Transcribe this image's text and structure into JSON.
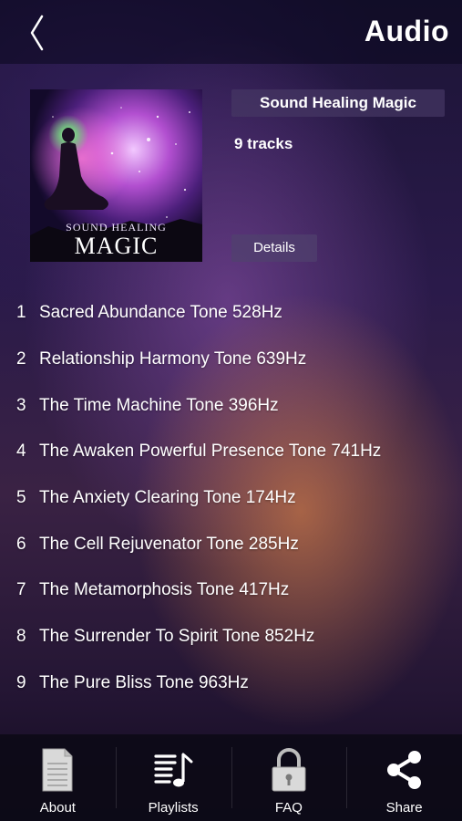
{
  "header": {
    "title": "Audio"
  },
  "album": {
    "name": "Sound Healing Magic",
    "track_count": "9 tracks",
    "details_label": "Details",
    "cover_text_small": "SOUND HEALING",
    "cover_text_large": "MAGIC"
  },
  "tracks": [
    {
      "num": "1",
      "title": "Sacred Abundance Tone 528Hz"
    },
    {
      "num": "2",
      "title": "Relationship Harmony Tone 639Hz"
    },
    {
      "num": "3",
      "title": "The Time Machine Tone 396Hz"
    },
    {
      "num": "4",
      "title": "The Awaken Powerful Presence Tone 741Hz"
    },
    {
      "num": "5",
      "title": "The Anxiety Clearing Tone 174Hz"
    },
    {
      "num": "6",
      "title": "The Cell Rejuvenator Tone 285Hz"
    },
    {
      "num": "7",
      "title": "The Metamorphosis Tone 417Hz"
    },
    {
      "num": "8",
      "title": "The Surrender To Spirit Tone 852Hz"
    },
    {
      "num": "9",
      "title": "The Pure Bliss Tone 963Hz"
    }
  ],
  "tabs": [
    {
      "label": "About",
      "icon": "document-icon"
    },
    {
      "label": "Playlists",
      "icon": "playlist-icon"
    },
    {
      "label": "FAQ",
      "icon": "lock-icon"
    },
    {
      "label": "Share",
      "icon": "share-icon"
    }
  ],
  "colors": {
    "tab_icon": "#d9d9d9",
    "panel": "#463764"
  }
}
